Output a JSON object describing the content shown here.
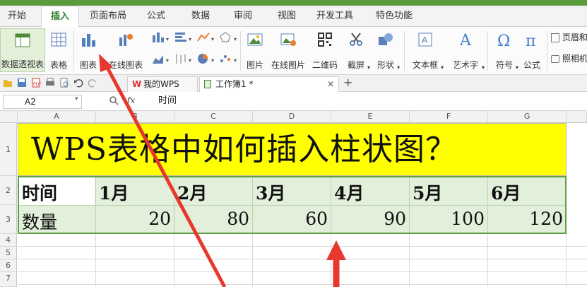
{
  "menu_tabs": [
    "开始",
    "插入",
    "页面布局",
    "公式",
    "数据",
    "审阅",
    "视图",
    "开发工具",
    "特色功能"
  ],
  "active_tab": "插入",
  "ribbon": {
    "pivot_table": "数据透视表",
    "table": "表格",
    "chart": "图表",
    "online_chart": "在线图表",
    "picture": "图片",
    "online_picture": "在线图片",
    "qr_code": "二维码",
    "screenshot": "截屏",
    "shapes": "形状",
    "text_box": "文本框",
    "art_text": "艺术字",
    "symbol": "符号",
    "formula": "公式",
    "header_footer": "页眉和",
    "camera": "照相机"
  },
  "doc_tabs": [
    {
      "label": "我的WPS"
    },
    {
      "label": "工作簿1 *"
    }
  ],
  "add_tab": "+",
  "formula_bar": {
    "cell_ref": "A2",
    "fx": "fx",
    "content": "时间"
  },
  "columns": [
    "A",
    "B",
    "C",
    "D",
    "E",
    "F",
    "G"
  ],
  "rows": [
    "1",
    "2",
    "3",
    "4",
    "5",
    "6",
    "7"
  ],
  "sheet": {
    "title": "WPS表格中如何插入柱状图？",
    "row2": [
      "时间",
      "1月",
      "2月",
      "3月",
      "4月",
      "5月",
      "6月"
    ],
    "row3_label": "数量",
    "row3_values": [
      "20",
      "80",
      "60",
      "90",
      "100",
      "120"
    ]
  },
  "colors": {
    "accent": "#2f7d2f",
    "title_fill": "#ffff00",
    "data_fill": "#e2efda",
    "data_border": "#5f9f47",
    "arrow": "#e8372c"
  }
}
